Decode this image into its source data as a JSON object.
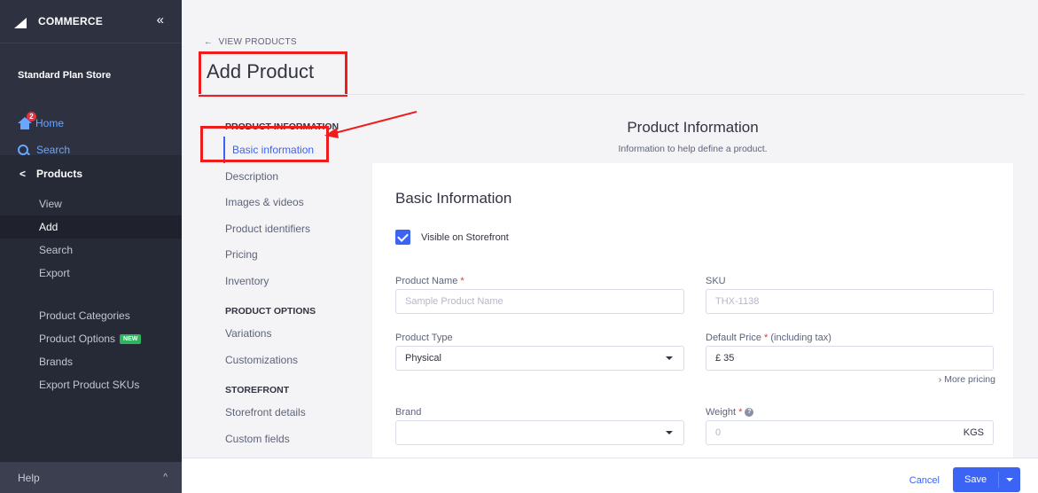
{
  "sidebar": {
    "logo": "COMMERCE",
    "logo_prefix": "BIG",
    "collapse_glyph": "«",
    "store_name": "Standard Plan Store",
    "home": {
      "label": "Home",
      "badge": "2"
    },
    "search": {
      "label": "Search"
    },
    "products": {
      "title": "Products",
      "items": [
        {
          "label": "View",
          "active": false
        },
        {
          "label": "Add",
          "active": true
        },
        {
          "label": "Search",
          "active": false
        },
        {
          "label": "Export",
          "active": false
        }
      ],
      "items2": [
        {
          "label": "Product Categories"
        },
        {
          "label": "Product Options",
          "badge": "NEW"
        },
        {
          "label": "Brands"
        },
        {
          "label": "Export Product SKUs"
        }
      ]
    },
    "help": "Help"
  },
  "main": {
    "back_link": "VIEW PRODUCTS",
    "page_title": "Add Product",
    "section_nav": {
      "product_information": {
        "header": "PRODUCT INFORMATION",
        "items": [
          "Basic information",
          "Description",
          "Images & videos",
          "Product identifiers",
          "Pricing",
          "Inventory"
        ]
      },
      "product_options": {
        "header": "PRODUCT OPTIONS",
        "items": [
          "Variations",
          "Customizations"
        ]
      },
      "storefront": {
        "header": "STOREFRONT",
        "items": [
          "Storefront details",
          "Custom fields"
        ]
      }
    },
    "info_title": "Product Information",
    "info_subtitle": "Information to help define a product.",
    "card": {
      "title": "Basic Information",
      "visible_label": "Visible on Storefront",
      "visible_checked": true,
      "product_name": {
        "label": "Product Name",
        "placeholder": "Sample Product Name",
        "required": "*"
      },
      "sku": {
        "label": "SKU",
        "placeholder": "THX-1138"
      },
      "product_type": {
        "label": "Product Type",
        "value": "Physical"
      },
      "default_price": {
        "label": "Default Price",
        "required": "*",
        "note": "(including tax)",
        "value": "£ 35"
      },
      "more_pricing": "More pricing",
      "brand": {
        "label": "Brand",
        "value": ""
      },
      "weight": {
        "label": "Weight",
        "required": "*",
        "placeholder": "0",
        "unit": "KGS"
      }
    }
  },
  "footer": {
    "cancel": "Cancel",
    "save": "Save"
  },
  "colors": {
    "accent": "#3c64f4",
    "annotation": "#ee1c1c",
    "sidebar": "#2d3140"
  }
}
